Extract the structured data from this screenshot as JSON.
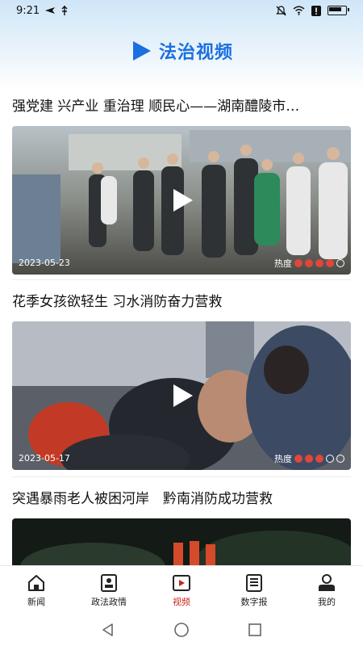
{
  "status_bar": {
    "time": "9:21"
  },
  "header": {
    "title": "法治视频"
  },
  "feed": [
    {
      "title": "强党建 兴产业 重治理 顺民心——湖南醴陵市…",
      "date": "2023-05-23",
      "heat_label": "热度",
      "rating": 4
    },
    {
      "title": "花季女孩欲轻生 习水消防奋力营救",
      "date": "2023-05-17",
      "heat_label": "热度",
      "rating": 3
    },
    {
      "title": "突遇暴雨老人被困河岸　黔南消防成功营救"
    }
  ],
  "bottom_nav": [
    {
      "label": "新闻",
      "icon": "home-icon"
    },
    {
      "label": "政法政情",
      "icon": "id-card-icon"
    },
    {
      "label": "视频",
      "icon": "video-icon",
      "active": true
    },
    {
      "label": "数字报",
      "icon": "newspaper-icon"
    },
    {
      "label": "我的",
      "icon": "user-icon"
    }
  ],
  "colors": {
    "accent": "#1b6fe0",
    "active_tab": "#c8251f",
    "rating_on": "#e0463a"
  }
}
